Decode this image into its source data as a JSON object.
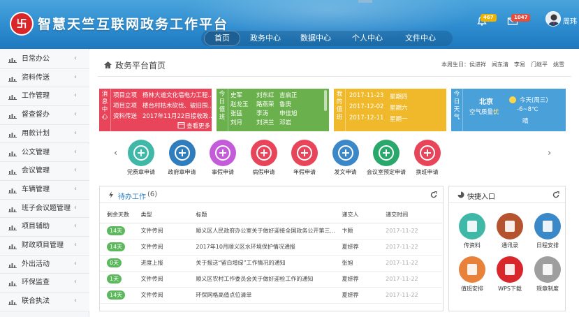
{
  "header": {
    "title": "智慧天竺互联网政务工作平台",
    "nav": [
      "首页",
      "政务中心",
      "数据中心",
      "个人中心",
      "文件中心"
    ],
    "bell_count": "467",
    "mail_count": "1047",
    "user_name": "周玮",
    "colors": {
      "bar": "#2d8ccf",
      "badge_bell": "#f0b400",
      "badge_mail": "#e74c3c"
    }
  },
  "sidebar": {
    "items": [
      {
        "label": "日常办公"
      },
      {
        "label": "资料传送"
      },
      {
        "label": "工作管理"
      },
      {
        "label": "督查督办"
      },
      {
        "label": "用款计划"
      },
      {
        "label": "公文管理"
      },
      {
        "label": "会议管理"
      },
      {
        "label": "车辆管理"
      },
      {
        "label": "班子会议题管理"
      },
      {
        "label": "项目辅助"
      },
      {
        "label": "财政项目管理"
      },
      {
        "label": "外出活动"
      },
      {
        "label": "环保监查"
      },
      {
        "label": "联合执法"
      }
    ]
  },
  "breadcrumb": {
    "title": "政务平台首页",
    "birthday": "本周生日：侯进祥　闻东清　李易　门继平　姚雪"
  },
  "cards": {
    "messages": {
      "label": "消息中心",
      "rows": [
        {
          "type": "项目立项",
          "text": "杨林大道文化墙电力工程..."
        },
        {
          "type": "项目立项",
          "text": "楼台村枯木砍伐、破旧围..."
        },
        {
          "type": "资料传送",
          "text": "2017年11月22日接收政..."
        }
      ],
      "more": "查看更多",
      "color": "#e8455a"
    },
    "duty_today": {
      "label": "今日值班",
      "names": [
        [
          "史军",
          "刘东红",
          "吉启正"
        ],
        [
          "赵龙玉",
          "路燕荣",
          "鲁庚"
        ],
        [
          "张猛",
          "李涛",
          "申佳旭"
        ],
        [
          "刘月",
          "刘洪兰",
          "邓岩"
        ],
        [
          "",
          "",
          ""
        ]
      ],
      "color": "#6ab04c"
    },
    "my_duty": {
      "label": "我的值班",
      "rows": [
        {
          "date": "2017-11-23",
          "week": "星期四"
        },
        {
          "date": "2017-12-02",
          "week": "星期六"
        },
        {
          "date": "2017-12-11",
          "week": "星期一"
        }
      ],
      "color": "#f0b92c"
    },
    "weather": {
      "label": "今日天气",
      "city": "北京",
      "aqi_label": "空气质量：",
      "aqi": "优",
      "day": "今天(周三)",
      "temp": "-6~8℃",
      "desc": "晴",
      "color": "#4aa0d8"
    }
  },
  "functions": [
    {
      "label": "党费章申请",
      "color": "#3fb8a8"
    },
    {
      "label": "政府章申请",
      "color": "#2f7dbd"
    },
    {
      "label": "事假申请",
      "color": "#c45bd8"
    },
    {
      "label": "病假申请",
      "color": "#e8455a"
    },
    {
      "label": "年假申请",
      "color": "#e8455a"
    },
    {
      "label": "发文申请",
      "color": "#3a88c8"
    },
    {
      "label": "会议室预定申请",
      "color": "#2aa86b"
    },
    {
      "label": "换班申请",
      "color": "#e8455a"
    }
  ],
  "pending": {
    "title": "待办工作",
    "count": "(6)",
    "columns": [
      "剩余天数",
      "类型",
      "标题",
      "递交人",
      "递交时间"
    ],
    "rows": [
      {
        "days": "14天",
        "type": "文件传阅",
        "title": "顺义区人民政府办公室关于做好迎接全国政务公开第三...",
        "sender": "卞颖",
        "time": "2017-11-22"
      },
      {
        "days": "14天",
        "type": "文件传阅",
        "title": "2017年10月顺义区水环境保护情况通报",
        "sender": "夏妍荐",
        "time": "2017-11-22"
      },
      {
        "days": "0天",
        "type": "进度上报",
        "title": "关于报送“留白增绿”工作情况的通知",
        "sender": "张旭",
        "time": "2017-11-22"
      },
      {
        "days": "1天",
        "type": "文件传阅",
        "title": "顺义区农村工作委员会关于做好迎检工作的通知",
        "sender": "夏妍荐",
        "time": "2017-11-22"
      },
      {
        "days": "14天",
        "type": "文件传阅",
        "title": "环保网格高值点位清单",
        "sender": "夏妍荐",
        "time": "2017-11-22"
      }
    ]
  },
  "quick": {
    "title": "快捷入口",
    "items": [
      {
        "label": "传资料",
        "color": "#3fb8a8"
      },
      {
        "label": "通讯录",
        "color": "#b5532f"
      },
      {
        "label": "日程安排",
        "color": "#3a88c8"
      },
      {
        "label": "值班安排",
        "color": "#e8823a"
      },
      {
        "label": "WPS下载",
        "color": "#d9262a"
      },
      {
        "label": "规章制度",
        "color": "#9e9e9e"
      }
    ]
  }
}
